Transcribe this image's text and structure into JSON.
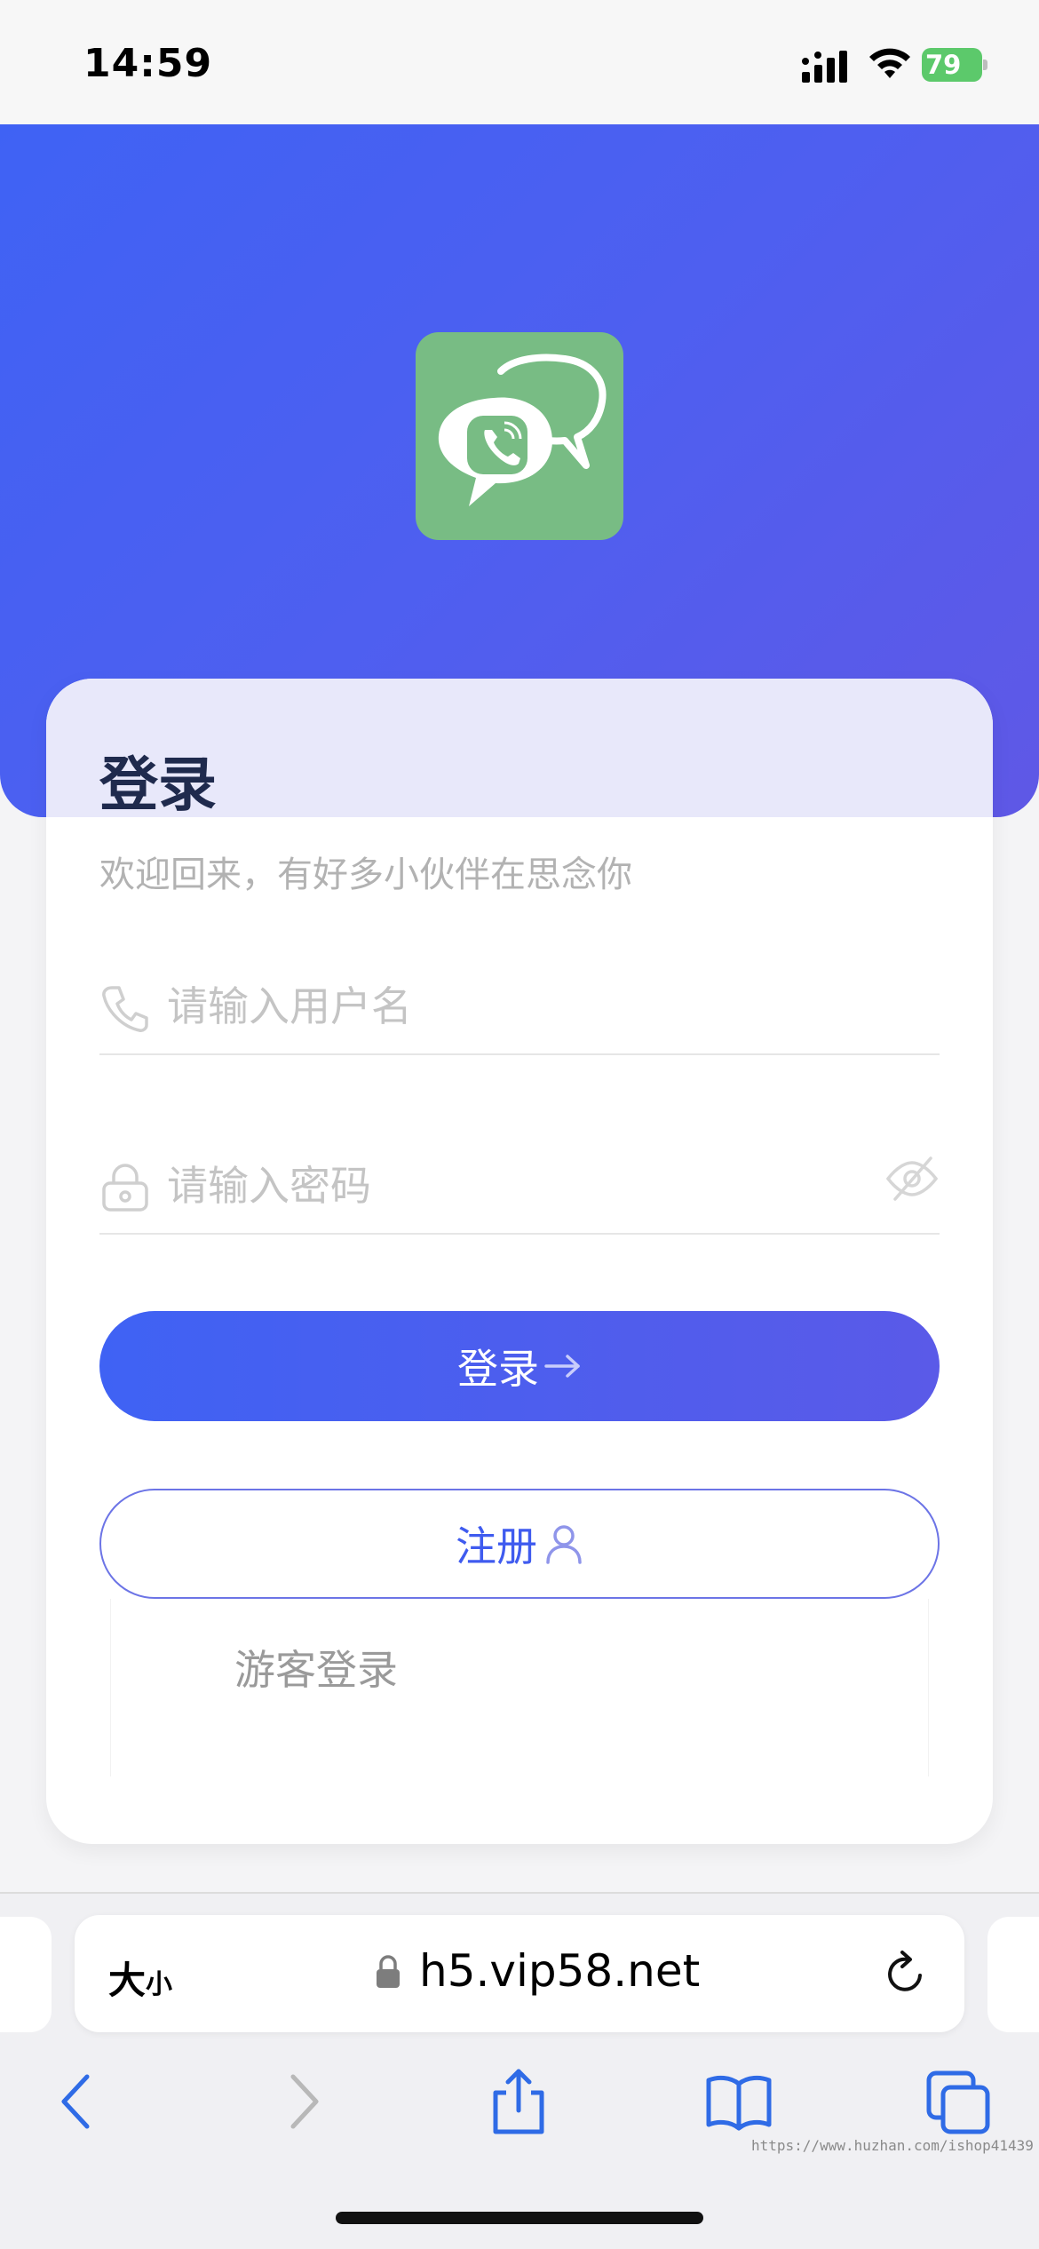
{
  "status_bar": {
    "time": "14:59",
    "battery_level": "79"
  },
  "login": {
    "title": "登录",
    "subtitle": "欢迎回来，有好多小伙伴在思念你",
    "username_placeholder": "请输入用户名",
    "password_placeholder": "请输入密码",
    "login_button": "登录",
    "register_button": "注册",
    "guest_login": "游客登录"
  },
  "browser": {
    "text_size_label": "大",
    "text_size_label_small": "小",
    "url": "h5.vip58.net"
  },
  "watermark": "https://www.huzhan.com/ishop41439",
  "icons": {
    "app_logo": "chat-bubbles-phone-icon",
    "username": "phone-icon",
    "password": "lock-icon",
    "visibility": "eye-off-icon",
    "login_arrow": "arrow-right-icon",
    "register": "person-icon"
  },
  "colors": {
    "primary": "#3f62f4",
    "primary_end": "#5f58e6",
    "logo_bg": "#78bc84",
    "battery": "#5cc96b",
    "title": "#1f2a4d"
  }
}
